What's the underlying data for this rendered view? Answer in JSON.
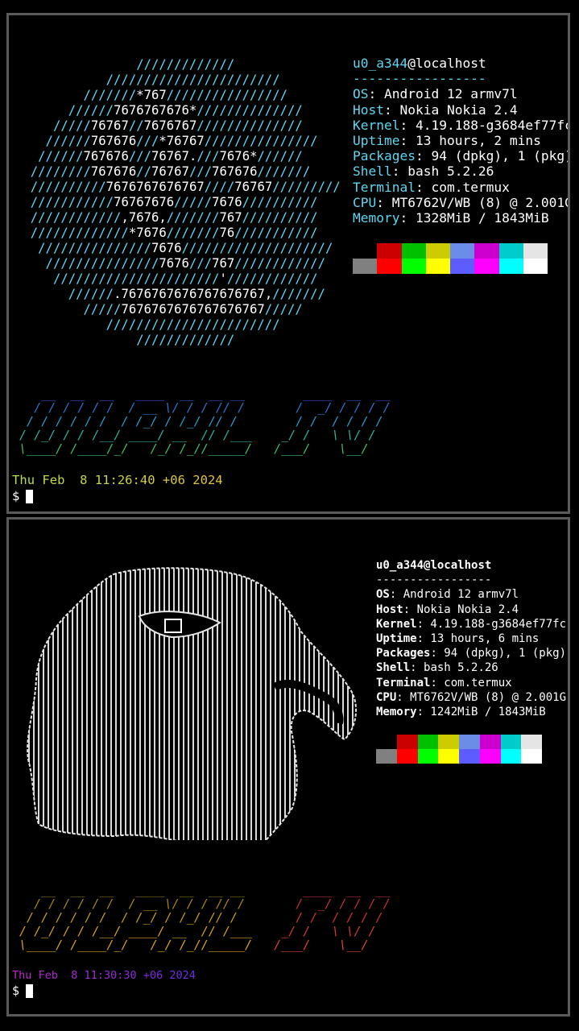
{
  "top": {
    "art_lines": [
      [
        [
          "d",
          "                /////////////"
        ]
      ],
      [
        [
          "d",
          "            ///////////////////////"
        ]
      ],
      [
        [
          "d",
          "         ///////"
        ],
        [
          "w",
          "*767"
        ],
        [
          "d",
          "////////////////"
        ]
      ],
      [
        [
          "d",
          "       //////"
        ],
        [
          "w",
          "7676767676*"
        ],
        [
          "d",
          "//////////////"
        ]
      ],
      [
        [
          "d",
          "     /////"
        ],
        [
          "w",
          "76767"
        ],
        [
          "d",
          "//"
        ],
        [
          "w",
          "7676767"
        ],
        [
          "d",
          "//////////////"
        ]
      ],
      [
        [
          "d",
          "    //////"
        ],
        [
          "w",
          "767676"
        ],
        [
          "d",
          "///"
        ],
        [
          "w",
          "*76767"
        ],
        [
          "d",
          "///////////////"
        ]
      ],
      [
        [
          "d",
          "   //////"
        ],
        [
          "w",
          "767676"
        ],
        [
          "d",
          "///"
        ],
        [
          "w",
          "76767."
        ],
        [
          "d",
          "///"
        ],
        [
          "w",
          "7676*"
        ],
        [
          "d",
          "//////"
        ]
      ],
      [
        [
          "d",
          "  ////////"
        ],
        [
          "w",
          "767676"
        ],
        [
          "d",
          "//"
        ],
        [
          "w",
          "76767"
        ],
        [
          "d",
          "///"
        ],
        [
          "w",
          "767676"
        ],
        [
          "d",
          "///////"
        ]
      ],
      [
        [
          "d",
          "  //////////"
        ],
        [
          "w",
          "7676767676767"
        ],
        [
          "d",
          "////"
        ],
        [
          "w",
          "76767"
        ],
        [
          "d",
          "/////////"
        ]
      ],
      [
        [
          "d",
          "  ///////////"
        ],
        [
          "w",
          "76767676"
        ],
        [
          "d",
          "/////"
        ],
        [
          "w",
          "7676"
        ],
        [
          "d",
          "//////////"
        ]
      ],
      [
        [
          "d",
          "  ////////////"
        ],
        [
          "w",
          ",7676,"
        ],
        [
          "d",
          "///////"
        ],
        [
          "w",
          "767"
        ],
        [
          "d",
          "//////////"
        ]
      ],
      [
        [
          "d",
          "  /////////////"
        ],
        [
          "w",
          "*7676"
        ],
        [
          "d",
          "///////"
        ],
        [
          "w",
          "76"
        ],
        [
          "d",
          "///////////"
        ]
      ],
      [
        [
          "d",
          "   ///////////////"
        ],
        [
          "w",
          "7676"
        ],
        [
          "d",
          "////////////////////"
        ]
      ],
      [
        [
          "d",
          "    ///////////////"
        ],
        [
          "w",
          "7676"
        ],
        [
          "d",
          "///"
        ],
        [
          "w",
          "767"
        ],
        [
          "d",
          "////////////"
        ]
      ],
      [
        [
          "d",
          "     //////////////////////"
        ],
        [
          "w",
          "'"
        ],
        [
          "d",
          "////////////"
        ]
      ],
      [
        [
          "d",
          "       //////"
        ],
        [
          "w",
          ".7676767676767676767,"
        ],
        [
          "d",
          "///////"
        ]
      ],
      [
        [
          "d",
          "         /////"
        ],
        [
          "w",
          "7676767676767676767"
        ],
        [
          "d",
          "/////"
        ]
      ],
      [
        [
          "d",
          "            ///////////////////////"
        ]
      ],
      [
        [
          "d",
          "                /////////////"
        ]
      ]
    ],
    "user": "u0_a344",
    "host": "@localhost",
    "separator": "-----------------",
    "info": [
      {
        "key": "OS",
        "value": ": Android 12 armv7l"
      },
      {
        "key": "Host",
        "value": ": Nokia Nokia 2.4"
      },
      {
        "key": "Kernel",
        "value": ": 4.19.188-g3684ef77fc"
      },
      {
        "key": "Uptime",
        "value": ": 13 hours, 2 mins"
      },
      {
        "key": "Packages",
        "value": ": 94 (dpkg), 1 (pkg)"
      },
      {
        "key": "Shell",
        "value": ": bash 5.2.26"
      },
      {
        "key": "Terminal",
        "value": ": com.termux"
      },
      {
        "key": "CPU",
        "value": ": MT6762V/WB (8) @ 2.001G"
      },
      {
        "key": "Memory",
        "value": ": 1328MiB / 1843MiB"
      }
    ],
    "banner_lines": [
      "    __  __  __   ____  __  __ __        ____  __  __",
      "   / / / / / /  / __ \\/ / / // /       /  _/ / / / /",
      "  / / / / / /  / /_/ / /_/ // /        / /  / / / /",
      " / /_/ / / /__/ ____/ __  // /___    _/ /   \\ \\/ /",
      " \\____/ /____/_/   /_/ /_//_____/   /___/    \\__/"
    ],
    "banner_colors": [
      "#2b4fd6",
      "#2e74d0",
      "#2a9ecf",
      "#2fb3a0",
      "#3fc06b"
    ],
    "date": "Thu Feb  8 11:26:40 +06 2024",
    "date_gradient": [
      "#b6e04a",
      "#e3c23a"
    ],
    "prompt": "$"
  },
  "bottom": {
    "user": "u0_a344",
    "host": "@localhost",
    "separator": "-----------------",
    "info": [
      {
        "key": "OS",
        "value": ": Android 12 armv7l"
      },
      {
        "key": "Host",
        "value": ": Nokia Nokia 2.4"
      },
      {
        "key": "Kernel",
        "value": ": 4.19.188-g3684ef77fc"
      },
      {
        "key": "Uptime",
        "value": ": 13 hours, 6 mins"
      },
      {
        "key": "Packages",
        "value": ": 94 (dpkg), 1 (pkg)"
      },
      {
        "key": "Shell",
        "value": ": bash 5.2.26"
      },
      {
        "key": "Terminal",
        "value": ": com.termux"
      },
      {
        "key": "CPU",
        "value": ": MT6762V/WB (8) @ 2.001G"
      },
      {
        "key": "Memory",
        "value": ": 1242MiB / 1843MiB"
      }
    ],
    "banner_lines": [
      "    __  __  __   ____  __  __ __        ____  __  __",
      "   / / / / / /  / __ \\/ / / // /       /  _/ / / / /",
      "  / / / / / /  / /_/ / /_/ // /        / /  / / / /",
      " / /_/ / / /__/ ____/ __  // /___    _/ /   \\ \\/ /",
      " \\____/ /____/_/   /_/ /_//_____/   /___/    \\__/"
    ],
    "banner_colors_left": [
      "#8a6f10",
      "#a88812",
      "#c4a01a",
      "#d5a21c",
      "#e0a11e"
    ],
    "banner_colors_right": [
      "#c42a2a",
      "#c9302c",
      "#d13330",
      "#d83a32",
      "#e04535"
    ],
    "date": "Thu Feb  8 11:30:30 +06 2024",
    "date_gradient": [
      "#c026c9",
      "#6a2fe0"
    ],
    "prompt": "$"
  },
  "palette": {
    "dark": [
      "#808080",
      "#cc0000",
      "#00c000",
      "#cccc00",
      "#6b8de8",
      "#cc00cc",
      "#00cccc",
      "#e5e5e5"
    ],
    "bright": [
      "#808080",
      "#ff0000",
      "#00ff00",
      "#ffff00",
      "#5c5cff",
      "#ff00ff",
      "#00ffff",
      "#ffffff"
    ],
    "bottom_dark": [
      "#000000",
      "#cc0000",
      "#00c000",
      "#cccc00",
      "#6b8de8",
      "#cc00cc",
      "#00cccc",
      "#e5e5e5"
    ],
    "bottom_bright": [
      "#808080",
      "#ff0000",
      "#00ff00",
      "#ffff00",
      "#5c5cff",
      "#ff00ff",
      "#00ffff",
      "#ffffff"
    ]
  }
}
